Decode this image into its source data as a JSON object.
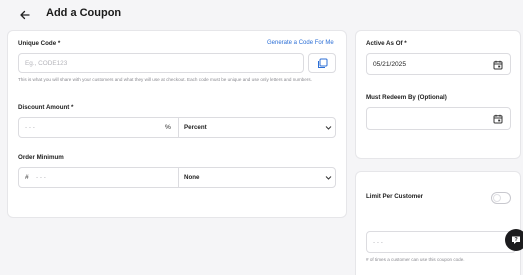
{
  "header": {
    "title": "Add a Coupon"
  },
  "unique_code": {
    "label": "Unique Code *",
    "generate_link": "Generate a Code For Me",
    "placeholder": "Eg., CODE123",
    "help": "This is what you will share with your customers and what they will use at checkout. Each code must be unique and use only letters and numbers."
  },
  "discount_amount": {
    "label": "Discount Amount *",
    "placeholder": "- - -",
    "unit_symbol": "%",
    "type_selected": "Percent"
  },
  "order_minimum": {
    "label": "Order Minimum",
    "prefix_symbol": "#",
    "placeholder": "- - -",
    "type_selected": "None"
  },
  "dates": {
    "active_label": "Active As Of *",
    "active_value": "05/21/2025",
    "redeem_label": "Must Redeem By (Optional)",
    "redeem_value": ""
  },
  "limit": {
    "label": "Limit Per Customer",
    "toggle_on": false,
    "placeholder": "- - -",
    "help": "# of times a customer can use this coupon code."
  },
  "icons": {
    "back": "arrow-left-icon",
    "copy": "copy-icon",
    "chevron": "chevron-down-icon",
    "calendar": "calendar-icon",
    "help": "help-icon"
  },
  "colors": {
    "link": "#2c6fd6",
    "fab": "#1c1c1e"
  }
}
